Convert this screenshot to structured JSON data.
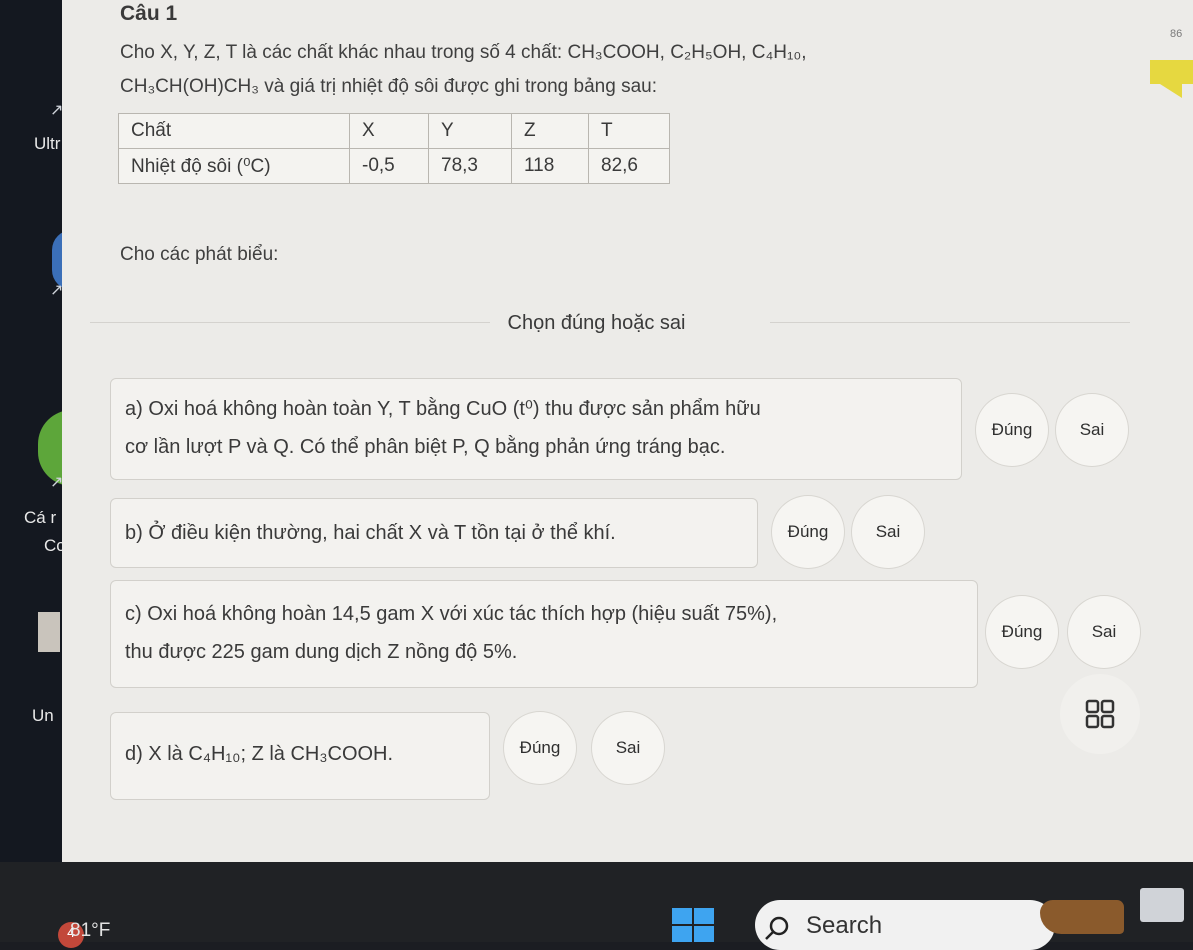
{
  "desktop": {
    "labels": [
      "Ultr",
      "Cá r",
      "Cc",
      "Un"
    ]
  },
  "question": {
    "title": "Câu 1",
    "corner_number": "86",
    "intro_line1": "Cho X, Y, Z, T là các chất khác nhau trong số 4 chất: CH₃COOH, C₂H₅OH, C₄H₁₀,",
    "intro_line2": "CH₃CH(OH)CH₃ và giá trị nhiệt độ sôi được ghi trong bảng sau:",
    "table": {
      "header": [
        "Chất",
        "X",
        "Y",
        "Z",
        "T"
      ],
      "row_label": "Nhiệt độ sôi (⁰C)",
      "values": [
        "-0,5",
        "78,3",
        "118",
        "82,6"
      ]
    },
    "prompt": "Cho các phát biểu:",
    "instruction": "Chọn đúng hoặc sai"
  },
  "statements": [
    {
      "line1": "a) Oxi hoá không hoàn toàn Y, T bằng CuO (t⁰) thu được sản phẩm hữu",
      "line2": "cơ lần lượt P và Q. Có thể phân biệt P, Q bằng phản ứng tráng bạc.",
      "true_label": "Đúng",
      "false_label": "Sai"
    },
    {
      "line1": "b) Ở điều kiện thường, hai chất X và T tồn tại ở thể khí.",
      "line2": "",
      "true_label": "Đúng",
      "false_label": "Sai"
    },
    {
      "line1": "c) Oxi hoá không hoàn 14,5 gam X với xúc tác thích hợp (hiệu suất 75%),",
      "line2": "thu được 225 gam dung dịch Z nồng độ 5%.",
      "true_label": "Đúng",
      "false_label": "Sai"
    },
    {
      "line1": "d) X là C₄H₁₀; Z là CH₃COOH.",
      "line2": "",
      "true_label": "Đúng",
      "false_label": "Sai"
    }
  ],
  "taskbar": {
    "weather": "81°F",
    "weather_badge": "4",
    "search_label": "Search"
  }
}
